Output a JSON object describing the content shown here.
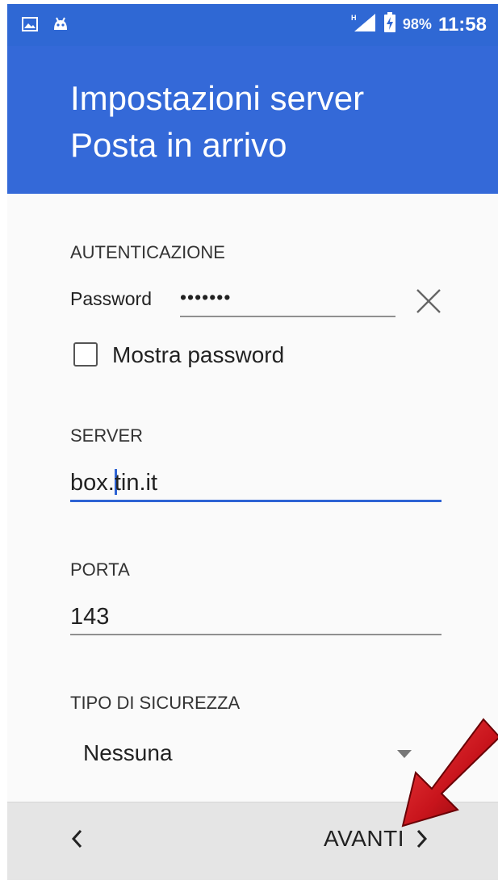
{
  "status_bar": {
    "icons": [
      "image-icon",
      "android-icon",
      "signal-icon",
      "battery-charging-icon"
    ],
    "network_label": "H",
    "battery": "98%",
    "time": "11:58"
  },
  "header": {
    "title_line1": "Impostazioni server",
    "title_line2": "Posta in arrivo"
  },
  "authentication": {
    "section_label": "AUTENTICAZIONE",
    "password_label": "Password",
    "password_value": "•••••••",
    "clear_icon": "close-icon",
    "show_password_label": "Mostra password",
    "show_password_checked": false
  },
  "server": {
    "section_label": "SERVER",
    "value_before_cursor": "box.",
    "value_after_cursor": "tin.it"
  },
  "port": {
    "section_label": "PORTA",
    "value": "143"
  },
  "security": {
    "section_label": "TIPO DI SICUREZZA",
    "selected_value": "Nessuna"
  },
  "bottom_bar": {
    "back_icon": "chevron-left-icon",
    "next_label": "AVANTI",
    "next_icon": "chevron-right-icon"
  },
  "colors": {
    "header": "#3469d8",
    "status_bar": "#2f68d4",
    "accent": "#2e63d4",
    "annotation_arrow": "#c8141c"
  }
}
